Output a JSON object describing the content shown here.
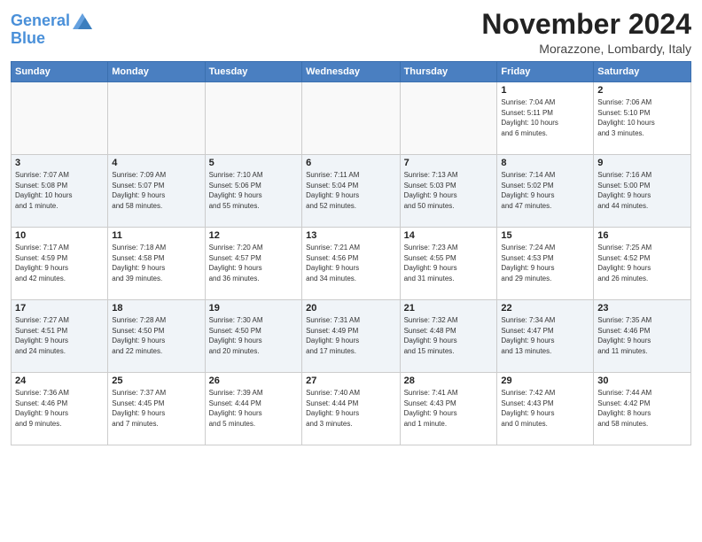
{
  "header": {
    "logo_line1": "General",
    "logo_line2": "Blue",
    "month": "November 2024",
    "location": "Morazzone, Lombardy, Italy"
  },
  "weekdays": [
    "Sunday",
    "Monday",
    "Tuesday",
    "Wednesday",
    "Thursday",
    "Friday",
    "Saturday"
  ],
  "weeks": [
    [
      {
        "day": "",
        "info": ""
      },
      {
        "day": "",
        "info": ""
      },
      {
        "day": "",
        "info": ""
      },
      {
        "day": "",
        "info": ""
      },
      {
        "day": "",
        "info": ""
      },
      {
        "day": "1",
        "info": "Sunrise: 7:04 AM\nSunset: 5:11 PM\nDaylight: 10 hours\nand 6 minutes."
      },
      {
        "day": "2",
        "info": "Sunrise: 7:06 AM\nSunset: 5:10 PM\nDaylight: 10 hours\nand 3 minutes."
      }
    ],
    [
      {
        "day": "3",
        "info": "Sunrise: 7:07 AM\nSunset: 5:08 PM\nDaylight: 10 hours\nand 1 minute."
      },
      {
        "day": "4",
        "info": "Sunrise: 7:09 AM\nSunset: 5:07 PM\nDaylight: 9 hours\nand 58 minutes."
      },
      {
        "day": "5",
        "info": "Sunrise: 7:10 AM\nSunset: 5:06 PM\nDaylight: 9 hours\nand 55 minutes."
      },
      {
        "day": "6",
        "info": "Sunrise: 7:11 AM\nSunset: 5:04 PM\nDaylight: 9 hours\nand 52 minutes."
      },
      {
        "day": "7",
        "info": "Sunrise: 7:13 AM\nSunset: 5:03 PM\nDaylight: 9 hours\nand 50 minutes."
      },
      {
        "day": "8",
        "info": "Sunrise: 7:14 AM\nSunset: 5:02 PM\nDaylight: 9 hours\nand 47 minutes."
      },
      {
        "day": "9",
        "info": "Sunrise: 7:16 AM\nSunset: 5:00 PM\nDaylight: 9 hours\nand 44 minutes."
      }
    ],
    [
      {
        "day": "10",
        "info": "Sunrise: 7:17 AM\nSunset: 4:59 PM\nDaylight: 9 hours\nand 42 minutes."
      },
      {
        "day": "11",
        "info": "Sunrise: 7:18 AM\nSunset: 4:58 PM\nDaylight: 9 hours\nand 39 minutes."
      },
      {
        "day": "12",
        "info": "Sunrise: 7:20 AM\nSunset: 4:57 PM\nDaylight: 9 hours\nand 36 minutes."
      },
      {
        "day": "13",
        "info": "Sunrise: 7:21 AM\nSunset: 4:56 PM\nDaylight: 9 hours\nand 34 minutes."
      },
      {
        "day": "14",
        "info": "Sunrise: 7:23 AM\nSunset: 4:55 PM\nDaylight: 9 hours\nand 31 minutes."
      },
      {
        "day": "15",
        "info": "Sunrise: 7:24 AM\nSunset: 4:53 PM\nDaylight: 9 hours\nand 29 minutes."
      },
      {
        "day": "16",
        "info": "Sunrise: 7:25 AM\nSunset: 4:52 PM\nDaylight: 9 hours\nand 26 minutes."
      }
    ],
    [
      {
        "day": "17",
        "info": "Sunrise: 7:27 AM\nSunset: 4:51 PM\nDaylight: 9 hours\nand 24 minutes."
      },
      {
        "day": "18",
        "info": "Sunrise: 7:28 AM\nSunset: 4:50 PM\nDaylight: 9 hours\nand 22 minutes."
      },
      {
        "day": "19",
        "info": "Sunrise: 7:30 AM\nSunset: 4:50 PM\nDaylight: 9 hours\nand 20 minutes."
      },
      {
        "day": "20",
        "info": "Sunrise: 7:31 AM\nSunset: 4:49 PM\nDaylight: 9 hours\nand 17 minutes."
      },
      {
        "day": "21",
        "info": "Sunrise: 7:32 AM\nSunset: 4:48 PM\nDaylight: 9 hours\nand 15 minutes."
      },
      {
        "day": "22",
        "info": "Sunrise: 7:34 AM\nSunset: 4:47 PM\nDaylight: 9 hours\nand 13 minutes."
      },
      {
        "day": "23",
        "info": "Sunrise: 7:35 AM\nSunset: 4:46 PM\nDaylight: 9 hours\nand 11 minutes."
      }
    ],
    [
      {
        "day": "24",
        "info": "Sunrise: 7:36 AM\nSunset: 4:46 PM\nDaylight: 9 hours\nand 9 minutes."
      },
      {
        "day": "25",
        "info": "Sunrise: 7:37 AM\nSunset: 4:45 PM\nDaylight: 9 hours\nand 7 minutes."
      },
      {
        "day": "26",
        "info": "Sunrise: 7:39 AM\nSunset: 4:44 PM\nDaylight: 9 hours\nand 5 minutes."
      },
      {
        "day": "27",
        "info": "Sunrise: 7:40 AM\nSunset: 4:44 PM\nDaylight: 9 hours\nand 3 minutes."
      },
      {
        "day": "28",
        "info": "Sunrise: 7:41 AM\nSunset: 4:43 PM\nDaylight: 9 hours\nand 1 minute."
      },
      {
        "day": "29",
        "info": "Sunrise: 7:42 AM\nSunset: 4:43 PM\nDaylight: 9 hours\nand 0 minutes."
      },
      {
        "day": "30",
        "info": "Sunrise: 7:44 AM\nSunset: 4:42 PM\nDaylight: 8 hours\nand 58 minutes."
      }
    ]
  ]
}
